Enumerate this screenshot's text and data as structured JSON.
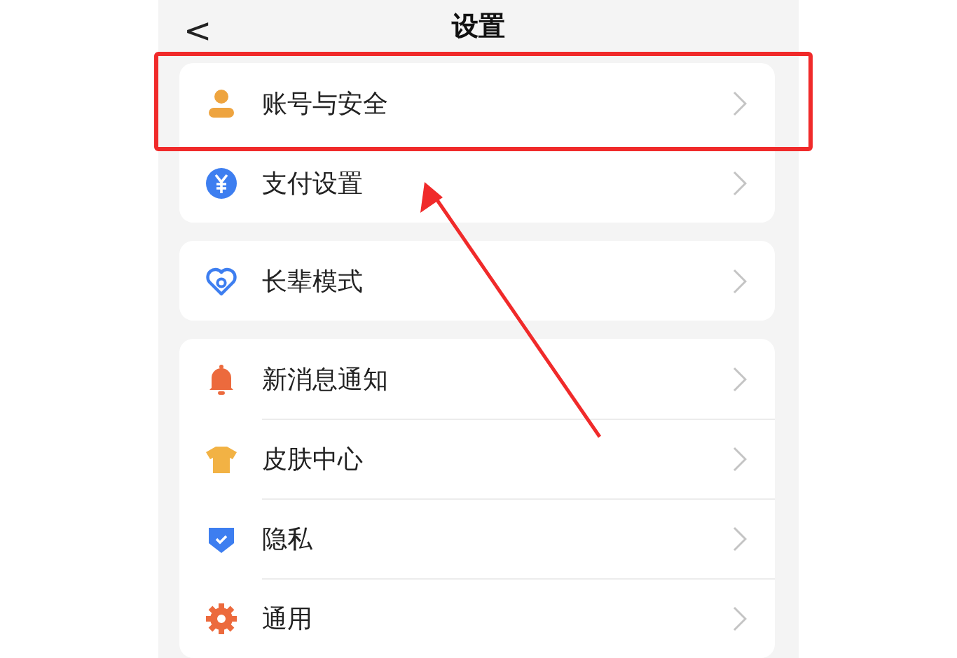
{
  "header": {
    "back": "<",
    "title": "设置"
  },
  "groups": [
    {
      "items": [
        {
          "label": "账号与安全",
          "kind": "person",
          "annotated": true
        },
        {
          "label": "支付设置",
          "kind": "yuan",
          "annotated": false
        }
      ]
    },
    {
      "items": [
        {
          "label": "长辈模式",
          "kind": "heart",
          "annotated": false
        }
      ]
    },
    {
      "items": [
        {
          "label": "新消息通知",
          "kind": "bell",
          "annotated": false
        },
        {
          "label": "皮肤中心",
          "kind": "shirt",
          "annotated": false
        },
        {
          "label": "隐私",
          "kind": "shield",
          "annotated": false
        },
        {
          "label": "通用",
          "kind": "gear",
          "annotated": false
        }
      ]
    }
  ]
}
